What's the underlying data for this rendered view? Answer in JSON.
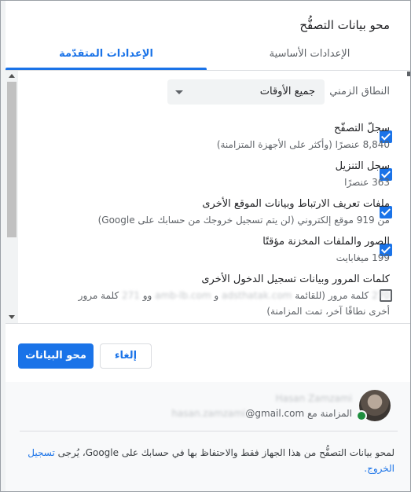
{
  "dialog": {
    "title": "محو بيانات التصفُّح"
  },
  "tabs": {
    "basic": "الإعدادات الأساسية",
    "advanced": "الإعدادات المتقدّمة"
  },
  "time_range": {
    "label": "النطاق الزمني",
    "value": "جميع الأوقات"
  },
  "items": [
    {
      "title": "سجلّ التصفّح",
      "desc": "8,840 عنصرًا (وأكثر على الأجهزة المتزامنة)",
      "checked": true
    },
    {
      "title": "سجل التنزيل",
      "desc": "363 عنصرًا",
      "checked": true
    },
    {
      "title": "ملفات تعريف الارتباط وبيانات الموقع الأخرى",
      "desc": "من 919 موقع إلكتروني (لن يتم تسجيل خروجك من حسابك على Google)",
      "checked": true
    },
    {
      "title": "الصور والملفات المخزنة مؤقتًا",
      "desc": "199 ميغابايت",
      "checked": true
    },
    {
      "title": "كلمات المرور وبيانات تسجيل الدخول الأخرى",
      "desc_parts": {
        "count_a": "270",
        "text_a": "كلمة مرور (للقائمة",
        "site_a": "adsthatak.com",
        "and_a": "و",
        "site_b": "amb-lb.com",
        "and_b": "وو",
        "count_b": "271",
        "text_b": "كلمة مرور"
      },
      "desc_line2": "أخرى نطاقًا آخر، تمت المزامنة)",
      "checked": false
    }
  ],
  "buttons": {
    "clear": "محو البيانات",
    "cancel": "إلغاء"
  },
  "account": {
    "name": "Hasan Zamzami",
    "sync_prefix": "المزامنة مع",
    "email_hidden": "hasan.zamzami",
    "email_domain": "@gmail.com"
  },
  "footer": {
    "text": "لمحو بيانات التصفُّح من هذا الجهاز فقط والاحتفاظ بها في حسابك على Google، يُرجى",
    "link": "تسجيل الخروج."
  },
  "colors": {
    "accent": "#1a73e8",
    "text": "#202124",
    "secondary": "#5f6368",
    "footer_bg": "#f8f9fa"
  },
  "icons": {
    "checkbox_checked": "check-icon",
    "select_caret": "caret-down-icon",
    "sync_badge": "sync-badge-icon"
  }
}
